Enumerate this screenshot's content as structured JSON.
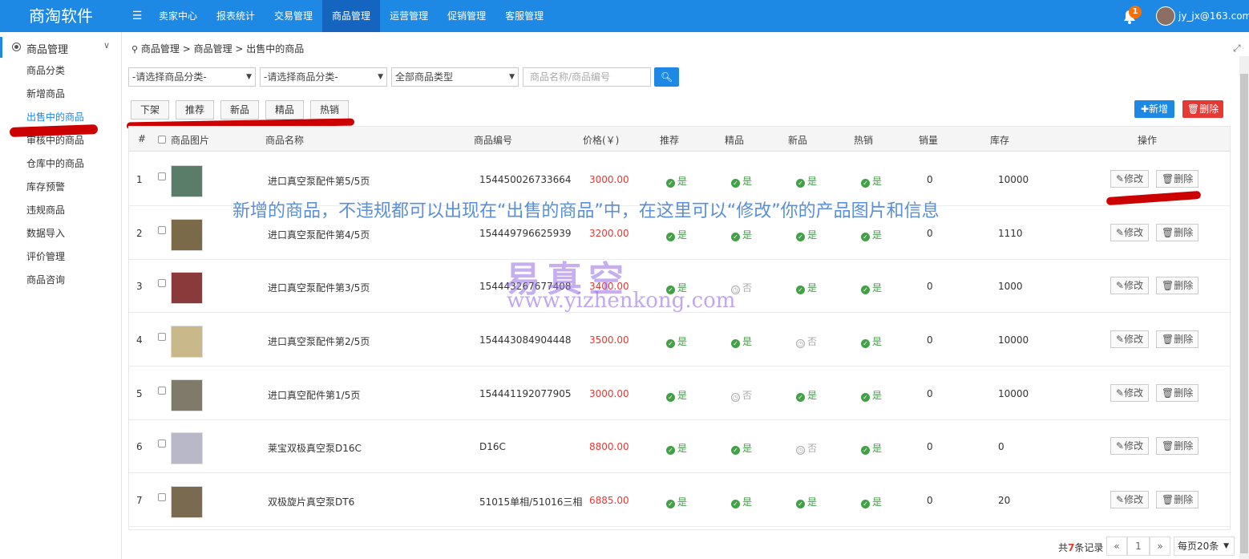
{
  "app": {
    "brand": "商淘软件"
  },
  "nav": {
    "items": [
      "卖家中心",
      "报表统计",
      "交易管理",
      "商品管理",
      "运营管理",
      "促销管理",
      "客服管理"
    ],
    "active_index": 3
  },
  "header": {
    "notifications": "1",
    "user": "jy_jx@163.com"
  },
  "sidebar": {
    "title": "商品管理",
    "items": [
      "商品分类",
      "新增商品",
      "出售中的商品",
      "审核中的商品",
      "仓库中的商品",
      "库存预警",
      "违规商品",
      "数据导入",
      "评价管理",
      "商品咨询"
    ],
    "active_index": 2
  },
  "breadcrumb": "商品管理 > 商品管理 > 出售中的商品",
  "filters": {
    "category1": "-请选择商品分类-",
    "category2": "-请选择商品分类-",
    "type": "全部商品类型",
    "search_placeholder": "商品名称/商品编号",
    "query_label": "查询"
  },
  "toolbar": {
    "buttons": [
      "下架",
      "推荐",
      "新品",
      "精品",
      "热销"
    ],
    "add_label": "新增",
    "delete_label": "删除"
  },
  "table": {
    "headers": [
      "#",
      "商品图片",
      "商品名称",
      "商品编号",
      "价格(￥)",
      "推荐",
      "精品",
      "新品",
      "热销",
      "销量",
      "库存",
      "操作"
    ],
    "yes_label": "是",
    "no_label": "否",
    "edit_label": "修改",
    "delete_label": "删除",
    "rows": [
      {
        "no": "1",
        "name": "进口真空泵配件第5/5页",
        "code": "154450026733664",
        "price": "3000.00",
        "recommend": true,
        "fine": true,
        "new": true,
        "hot": true,
        "sales": "0",
        "stock": "10000"
      },
      {
        "no": "2",
        "name": "进口真空泵配件第4/5页",
        "code": "154449796625939",
        "price": "3200.00",
        "recommend": true,
        "fine": true,
        "new": true,
        "hot": true,
        "sales": "0",
        "stock": "1110"
      },
      {
        "no": "3",
        "name": "进口真空泵配件第3/5页",
        "code": "154443267677408",
        "price": "3400.00",
        "recommend": true,
        "fine": false,
        "new": true,
        "hot": true,
        "sales": "0",
        "stock": "1000"
      },
      {
        "no": "4",
        "name": "进口真空泵配件第2/5页",
        "code": "154443084904448",
        "price": "3500.00",
        "recommend": true,
        "fine": true,
        "new": false,
        "hot": true,
        "sales": "0",
        "stock": "10000"
      },
      {
        "no": "5",
        "name": "进口真空配件第1/5页",
        "code": "154441192077905",
        "price": "3000.00",
        "recommend": true,
        "fine": false,
        "new": true,
        "hot": true,
        "sales": "0",
        "stock": "10000"
      },
      {
        "no": "6",
        "name": "莱宝双极真空泵D16C",
        "code": "D16C",
        "price": "8800.00",
        "recommend": true,
        "fine": true,
        "new": false,
        "hot": true,
        "sales": "0",
        "stock": "0"
      },
      {
        "no": "7",
        "name": "双极旋片真空泵DT6",
        "code": "51015单相/51016三相",
        "price": "6885.00",
        "recommend": true,
        "fine": true,
        "new": true,
        "hot": true,
        "sales": "0",
        "stock": "20"
      }
    ]
  },
  "annotation": "新增的商品，不违规都可以出现在“出售的商品”中，在这里可以“修改”你的产品图片和信息",
  "watermark": {
    "title": "易真空",
    "url": "www.yizhenkong.com"
  },
  "pagination": {
    "total_prefix": "共",
    "total_count": "7",
    "total_suffix": "条记录",
    "prev": "«",
    "page": "1",
    "next": "»",
    "page_size": "每页20条"
  },
  "colors": {
    "primary": "#1e88e5",
    "danger": "#e53935",
    "success": "#43a047",
    "thumbs": [
      "#5a7d6a",
      "#7a6a4a",
      "#8a3a3a",
      "#c9b98a",
      "#7f7a6a",
      "#b8b8c8",
      "#7a6a4f"
    ]
  }
}
